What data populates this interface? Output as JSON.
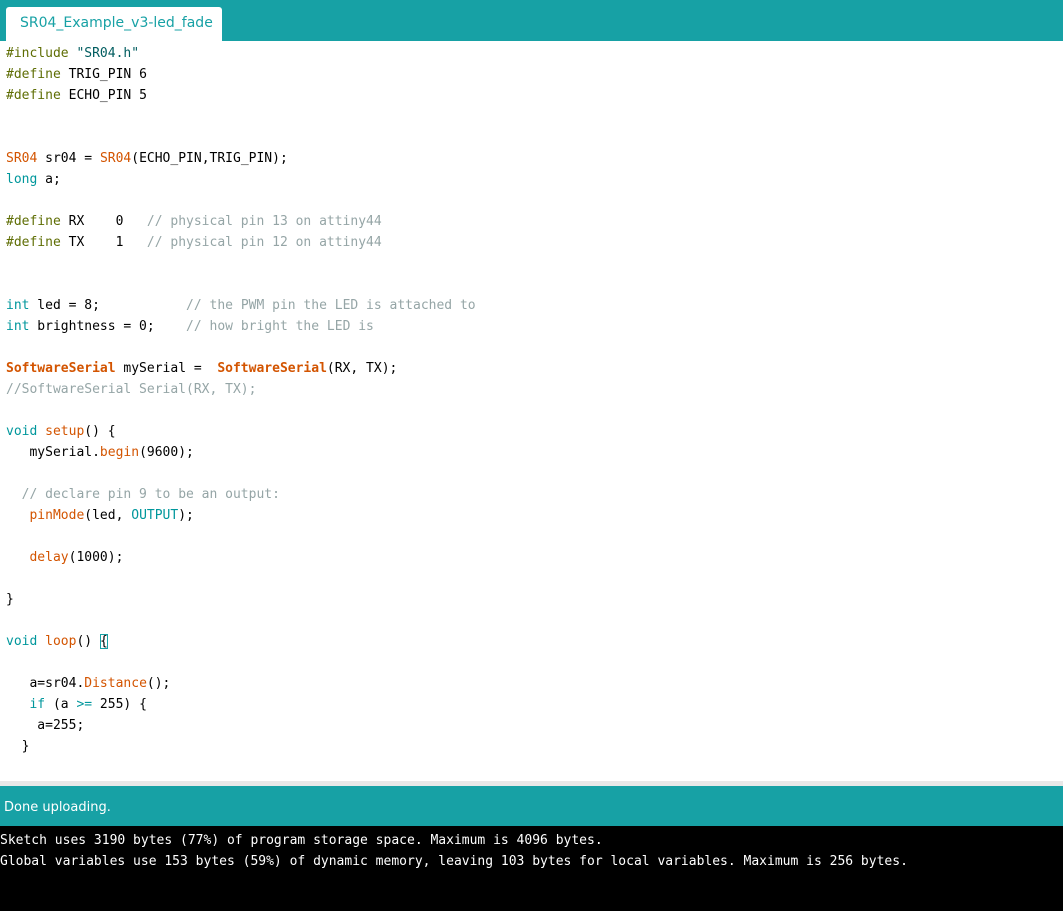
{
  "tab": {
    "label": "SR04_Example_v3-led_fade"
  },
  "code": {
    "l1_dir": "#include",
    "l1_str": "\"SR04.h\"",
    "l2_dir": "#define",
    "l2_rest": " TRIG_PIN 6",
    "l3_dir": "#define",
    "l3_rest": " ECHO_PIN 5",
    "l4_cls": "SR04",
    "l4_mid": " sr04 = ",
    "l4_fn": "SR04",
    "l4_rest": "(ECHO_PIN,TRIG_PIN);",
    "l5_kw": "long",
    "l5_rest": " a;",
    "l6_dir": "#define",
    "l6_rest": " RX    0   ",
    "l6_cm": "// physical pin 13 on attiny44",
    "l7_dir": "#define",
    "l7_rest": " TX    1   ",
    "l7_cm": "// physical pin 12 on attiny44",
    "l8_kw": "int",
    "l8_rest": " led = 8;           ",
    "l8_cm": "// the PWM pin the LED is attached to",
    "l9_kw": "int",
    "l9_rest": " brightness = 0;    ",
    "l9_cm": "// how bright the LED is",
    "l10_cls": "SoftwareSerial",
    "l10_mid": " mySerial =  ",
    "l10_fn": "SoftwareSerial",
    "l10_rest": "(RX, TX);",
    "l11_cm": "//SoftwareSerial Serial(RX, TX);",
    "l12_kw": "void",
    "l12_sp": " ",
    "l12_fn": "setup",
    "l12_rest": "() {",
    "l13_ind": "   mySerial.",
    "l13_fn": "begin",
    "l13_rest": "(9600);",
    "l14_ind": "  ",
    "l14_cm": "// declare pin 9 to be an output:",
    "l15_ind": "   ",
    "l15_fn": "pinMode",
    "l15_mid": "(led, ",
    "l15_kw": "OUTPUT",
    "l15_rest": ");",
    "l16_ind": "   ",
    "l16_fn": "delay",
    "l16_rest": "(1000);",
    "l17": "}",
    "l18_kw": "void",
    "l18_sp": " ",
    "l18_fn": "loop",
    "l18_mid": "() ",
    "l18_br": "{",
    "l19_ind": "   a=sr04.",
    "l19_fn": "Distance",
    "l19_rest": "();",
    "l20_ind": "   ",
    "l20_kw": "if",
    "l20_mid": " (a ",
    "l20_op": ">=",
    "l20_rest": " 255) {",
    "l21": "    a=255;",
    "l22": "  }"
  },
  "status": {
    "message": "Done uploading."
  },
  "console": {
    "line1": "Sketch uses 3190 bytes (77%) of program storage space. Maximum is 4096 bytes.",
    "line2": "Global variables use 153 bytes (59%) of dynamic memory, leaving 103 bytes for local variables. Maximum is 256 bytes."
  },
  "colors": {
    "accent": "#17a1a5",
    "directive": "#5e6d03",
    "keyword": "#00979c",
    "function": "#d35400",
    "comment": "#95a5a6",
    "console_bg": "#000000"
  }
}
